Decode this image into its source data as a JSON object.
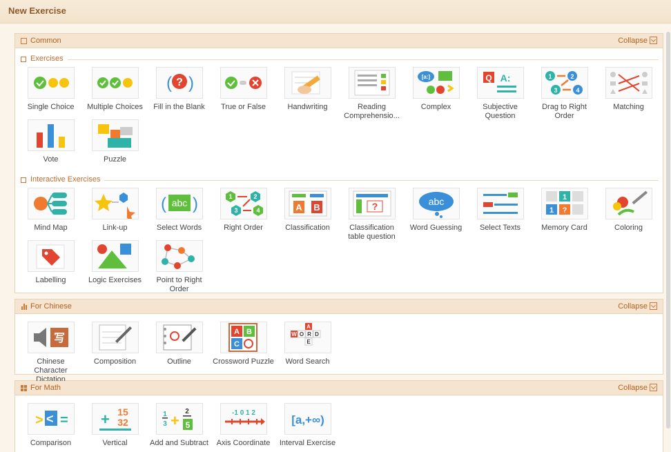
{
  "title": "New Exercise",
  "collapse_label": "Collapse",
  "sections": [
    {
      "title": "Common",
      "groups": [
        {
          "title": "Exercises",
          "items": [
            {
              "label": "Single Choice",
              "icon": "single-choice-icon"
            },
            {
              "label": "Multiple Choices",
              "icon": "multiple-choices-icon"
            },
            {
              "label": "Fill in the Blank",
              "icon": "fill-blank-icon"
            },
            {
              "label": "True or False",
              "icon": "true-false-icon"
            },
            {
              "label": "Handwriting",
              "icon": "handwriting-icon"
            },
            {
              "label": "Reading Comprehensio...",
              "icon": "reading-comprehension-icon"
            },
            {
              "label": "Complex",
              "icon": "complex-icon"
            },
            {
              "label": "Subjective Question",
              "icon": "subjective-question-icon"
            },
            {
              "label": "Drag to Right Order",
              "icon": "drag-order-icon"
            },
            {
              "label": "Matching",
              "icon": "matching-icon"
            },
            {
              "label": "Vote",
              "icon": "vote-icon"
            },
            {
              "label": "Puzzle",
              "icon": "puzzle-icon"
            }
          ]
        },
        {
          "title": "Interactive Exercises",
          "items": [
            {
              "label": "Mind Map",
              "icon": "mind-map-icon"
            },
            {
              "label": "Link-up",
              "icon": "link-up-icon"
            },
            {
              "label": "Select Words",
              "icon": "select-words-icon"
            },
            {
              "label": "Right Order",
              "icon": "right-order-icon"
            },
            {
              "label": "Classification",
              "icon": "classification-icon"
            },
            {
              "label": "Classification table question",
              "icon": "classification-table-icon"
            },
            {
              "label": "Word Guessing",
              "icon": "word-guessing-icon"
            },
            {
              "label": "Select Texts",
              "icon": "select-texts-icon"
            },
            {
              "label": "Memory Card",
              "icon": "memory-card-icon"
            },
            {
              "label": "Coloring",
              "icon": "coloring-icon"
            },
            {
              "label": "Labelling",
              "icon": "labelling-icon"
            },
            {
              "label": "Logic Exercises",
              "icon": "logic-exercises-icon"
            },
            {
              "label": "Point to Right Order",
              "icon": "point-order-icon"
            }
          ]
        }
      ]
    },
    {
      "title": "For Chinese",
      "groups": [
        {
          "title": "",
          "items": [
            {
              "label": "Chinese Character Dictation",
              "icon": "dictation-icon"
            },
            {
              "label": "Composition",
              "icon": "composition-icon"
            },
            {
              "label": "Outline",
              "icon": "outline-icon"
            },
            {
              "label": "Crossword Puzzle",
              "icon": "crossword-icon"
            },
            {
              "label": "Word Search",
              "icon": "word-search-icon"
            }
          ]
        }
      ]
    },
    {
      "title": "For Math",
      "groups": [
        {
          "title": "",
          "items": [
            {
              "label": "Comparison",
              "icon": "comparison-icon"
            },
            {
              "label": "Vertical",
              "icon": "vertical-icon"
            },
            {
              "label": "Add and Subtract",
              "icon": "add-subtract-icon"
            },
            {
              "label": "Axis Coordinate",
              "icon": "axis-coordinate-icon"
            },
            {
              "label": "Interval Exercise",
              "icon": "interval-exercise-icon"
            }
          ]
        }
      ]
    }
  ],
  "icon_text": {
    "fill_blank": "?",
    "select_words": "abc",
    "word_guessing": "abc",
    "classification": "A B",
    "crossword": "ABCQ",
    "word_search": "WORD",
    "dictation": "写",
    "math_vertical_top": "15",
    "math_vertical_bottom": "32",
    "axis_ticks": "-1 0 1 2",
    "interval": "[a,+∞)",
    "right_order_nums": "1 2 3 4",
    "complex": "[a:]",
    "subjective": "Q A:"
  },
  "colors": {
    "accent": "#b5601f",
    "green": "#5fbf3c",
    "yellow": "#f6c40e",
    "red": "#e2452f",
    "blue": "#3a8fd8",
    "teal": "#2fb3a8"
  }
}
